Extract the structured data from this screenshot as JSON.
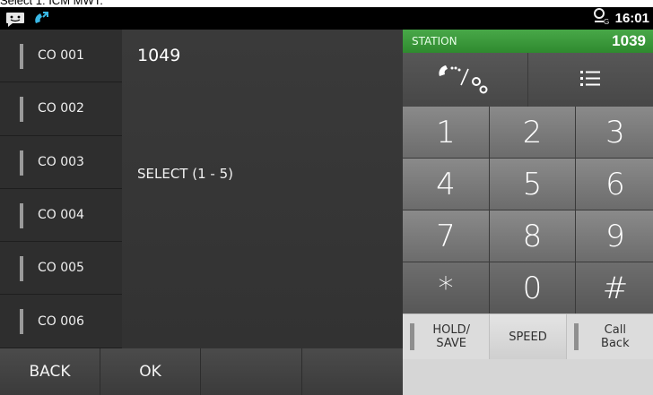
{
  "caption": "Select 1: ICM MWT.",
  "status_bar": {
    "time": "16:01"
  },
  "co_lines": [
    {
      "label": "CO 001"
    },
    {
      "label": "CO 002"
    },
    {
      "label": "CO 003"
    },
    {
      "label": "CO 004"
    },
    {
      "label": "CO 005"
    },
    {
      "label": "CO 006"
    }
  ],
  "main": {
    "number": "1049",
    "prompt": "SELECT (1 - 5)"
  },
  "bottom_bar": {
    "back": "BACK",
    "ok": "OK"
  },
  "station": {
    "label": "STATION",
    "number": "1039"
  },
  "keypad": [
    "1",
    "2",
    "3",
    "4",
    "5",
    "6",
    "7",
    "8",
    "9",
    "*",
    "0",
    "#"
  ],
  "functions": {
    "hold_save": "HOLD/\nSAVE",
    "speed": "SPEED",
    "call_back": "Call\nBack"
  },
  "colors": {
    "station_green": "#3a9a3a"
  }
}
